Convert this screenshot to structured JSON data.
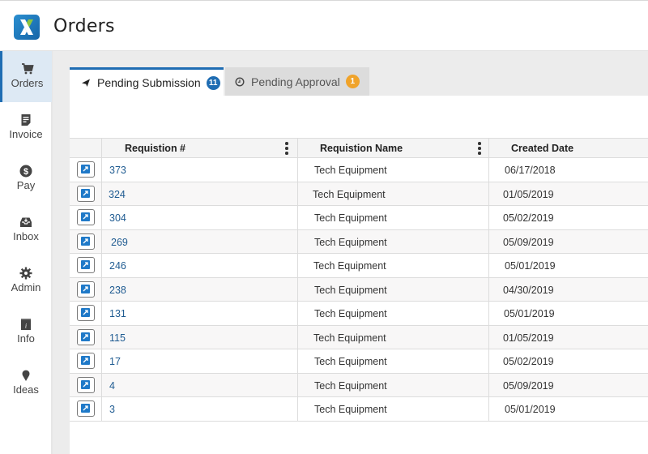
{
  "header": {
    "app_title": "Orders",
    "logo_icon": "x-logo",
    "colors": {
      "logo_blue": "#1f6db3",
      "logo_green": "#8cc63f"
    }
  },
  "sidebar": {
    "items": [
      {
        "label": "Orders",
        "icon": "cart-icon",
        "active": true
      },
      {
        "label": "Invoice",
        "icon": "invoice-icon",
        "active": false
      },
      {
        "label": "Pay",
        "icon": "dollar-circle-icon",
        "active": false
      },
      {
        "label": "Inbox",
        "icon": "inbox-icon",
        "active": false
      },
      {
        "label": "Admin",
        "icon": "gear-icon",
        "active": false
      },
      {
        "label": "Info",
        "icon": "info-book-icon",
        "active": false
      },
      {
        "label": "Ideas",
        "icon": "location-pin-icon",
        "active": false
      }
    ]
  },
  "tabs": [
    {
      "label": "Pending Submission",
      "icon": "send-arrow-icon",
      "count": "11",
      "badge_color": "#1f6db3",
      "active": true
    },
    {
      "label": "Pending Approval",
      "icon": "clock-icon",
      "count": "1",
      "badge_color": "#f0a32a",
      "active": false
    }
  ],
  "grid": {
    "columns": [
      {
        "label": "Requistion #",
        "has_menu": true
      },
      {
        "label": "Requistion Name",
        "has_menu": true
      },
      {
        "label": "Created Date",
        "has_menu": false
      }
    ],
    "rows": [
      {
        "number": "373",
        "name": "Tech Equipment",
        "date": "06/17/2018"
      },
      {
        "number": "324",
        "name": "Tech Equipment",
        "date": "01/05/2019"
      },
      {
        "number": "304",
        "name": "Tech Equipment",
        "date": "05/02/2019"
      },
      {
        "number": "269",
        "name": "Tech Equipment",
        "date": "05/09/2019"
      },
      {
        "number": "246",
        "name": "Tech Equipment",
        "date": "05/01/2019"
      },
      {
        "number": "238",
        "name": "Tech Equipment",
        "date": "04/30/2019"
      },
      {
        "number": "131",
        "name": "Tech Equipment",
        "date": "05/01/2019"
      },
      {
        "number": "115",
        "name": "Tech Equipment",
        "date": "01/05/2019"
      },
      {
        "number": "17",
        "name": "Tech Equipment",
        "date": "05/02/2019"
      },
      {
        "number": "4",
        "name": "Tech Equipment",
        "date": "05/09/2019"
      },
      {
        "number": "3",
        "name": "Tech Equipment",
        "date": "05/01/2019"
      }
    ],
    "row_action_icon": "open-external-icon",
    "link_color": "#1f5b91"
  }
}
